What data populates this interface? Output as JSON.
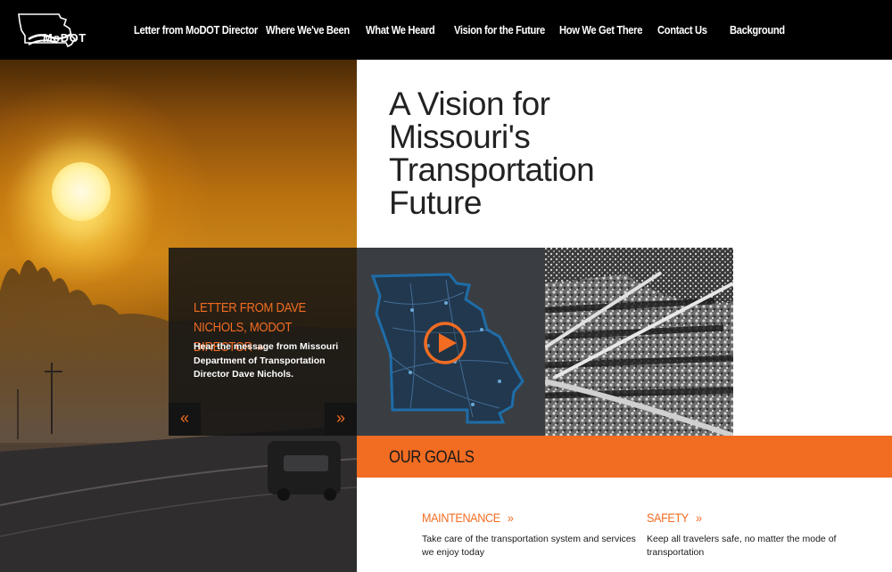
{
  "brand": {
    "logo_text": "MoDOT",
    "accent": "#f26c22",
    "nav_bg": "#000000"
  },
  "nav": {
    "items": [
      {
        "label": "Letter from MoDOT Director"
      },
      {
        "label": "Where We've Been"
      },
      {
        "label": "What We Heard"
      },
      {
        "label": "Vision for the Future"
      },
      {
        "label": "How We Get There"
      },
      {
        "label": "Contact Us"
      },
      {
        "label": "Background"
      }
    ]
  },
  "hero": {
    "headline": [
      "A Vision for",
      "Missouri's",
      "Transportation",
      "Future"
    ]
  },
  "slider": {
    "title": "Letter from Dave Nichols, MoDOT Director",
    "title_arrow": "»",
    "description": "Hear the message from Missouri Department of Transportation Director Dave Nichols.",
    "prev_icon": "«",
    "next_icon": "»"
  },
  "goals": {
    "heading": "Our Goals",
    "items": [
      {
        "title": "Maintenance",
        "chevron": "»",
        "description": "Take care of the transportation system and services we enjoy today"
      },
      {
        "title": "Safety",
        "chevron": "»",
        "description": "Keep all travelers safe, no matter the mode of transportation"
      }
    ]
  }
}
